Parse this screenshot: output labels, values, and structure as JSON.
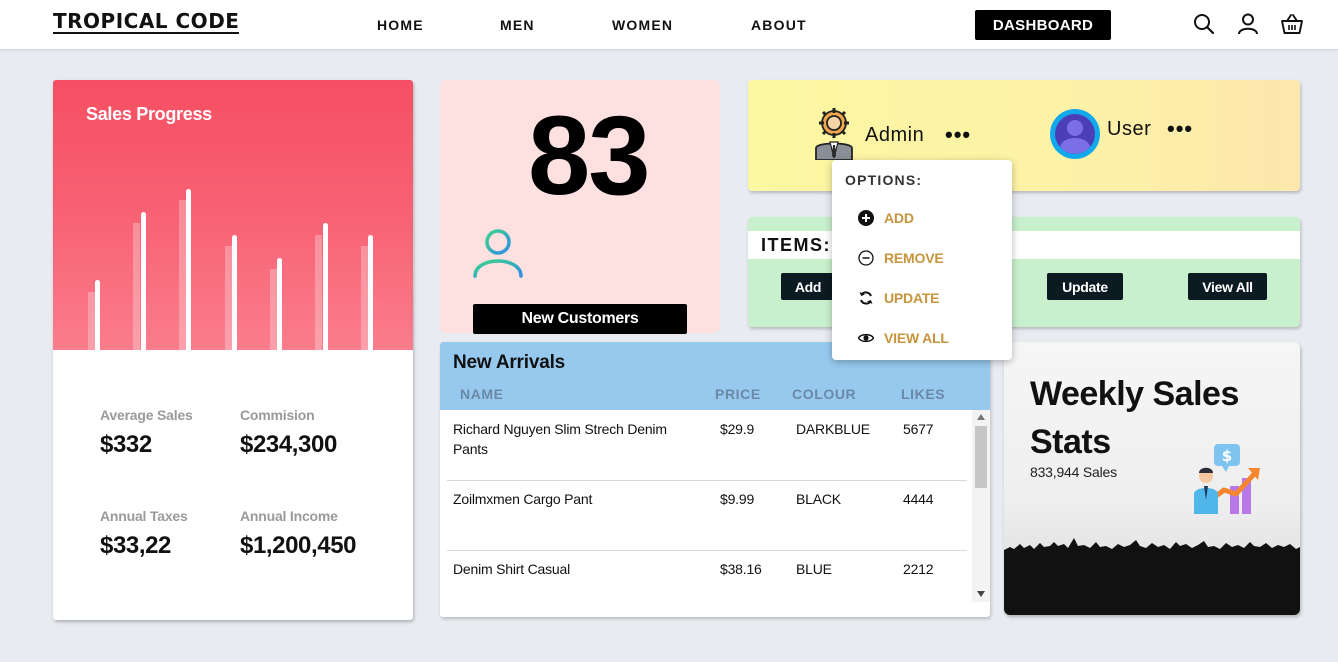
{
  "nav": {
    "brand": "TROPICAL CODE",
    "links": [
      "HOME",
      "MEN",
      "WOMEN",
      "ABOUT"
    ],
    "dashboard_label": "DASHBOARD",
    "icons": [
      "search-icon",
      "user-icon",
      "basket-icon"
    ]
  },
  "sales": {
    "title": "Sales Progress",
    "stats": [
      {
        "label": "Average Sales",
        "value": "$332"
      },
      {
        "label": "Commision",
        "value": "$234,300"
      },
      {
        "label": "Annual Taxes",
        "value": "$33,22"
      },
      {
        "label": "Annual Income",
        "value": "$1,200,450"
      }
    ]
  },
  "customers": {
    "count": "83",
    "button_label": "New Customers"
  },
  "users": {
    "admin_label": "Admin",
    "user_label": "User",
    "more_glyph": "•••"
  },
  "items": {
    "title": "ITEMS:",
    "buttons": [
      "Add",
      "Update",
      "View All"
    ]
  },
  "options_menu": {
    "title": "OPTIONS:",
    "items": [
      {
        "label": "ADD",
        "icon": "plus-circle-icon"
      },
      {
        "label": "REMOVE",
        "icon": "minus-circle-icon"
      },
      {
        "label": "UPDATE",
        "icon": "refresh-icon"
      },
      {
        "label": "VIEW ALL",
        "icon": "eye-icon"
      }
    ]
  },
  "arrivals": {
    "title": "New Arrivals",
    "columns": [
      "NAME",
      "PRICE",
      "COLOUR",
      "LIKES"
    ],
    "rows": [
      {
        "name": "Richard Nguyen Slim Strech Denim Pants",
        "price": "$29.9",
        "colour": "DARKBLUE",
        "likes": "5677"
      },
      {
        "name": "Zoilmxmen Cargo Pant",
        "price": "$9.99",
        "colour": "BLACK",
        "likes": "4444"
      },
      {
        "name": "Denim Shirt Casual",
        "price": "$38.16",
        "colour": "BLUE",
        "likes": "2212"
      }
    ]
  },
  "weekly": {
    "title": "Weekly Sales Stats",
    "sales_text": "833,944 Sales"
  },
  "colors": {
    "sales_gradient_top": "#f64f63",
    "customers_bg": "#fde0e0",
    "users_bg": "#fbf7a2",
    "items_bg": "#c9f0cc",
    "arrivals_header": "#97c9ee",
    "menu_accent": "#c8943c"
  }
}
